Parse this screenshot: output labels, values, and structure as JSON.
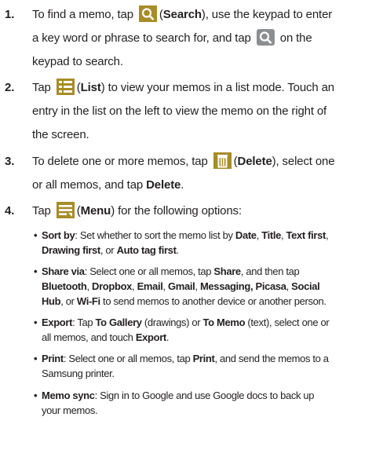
{
  "steps": [
    {
      "num": "1.",
      "t1": "To find a memo, tap ",
      "icon1": "search-icon",
      "b1": "Search",
      "t2": "), use the keypad to enter",
      "t3": "a key word or phrase to search for, and tap ",
      "icon2": "search-icon",
      "t4": " on the",
      "t5": "keypad to search."
    },
    {
      "num": "2.",
      "t1": "Tap ",
      "icon1": "list-icon",
      "b1": "List",
      "t2": ") to view your memos in a list mode. Touch an",
      "t3": "entry in the list on the left to view the memo on the right of",
      "t4": "the screen."
    },
    {
      "num": "3.",
      "t1": "To delete one or more memos, tap ",
      "icon1": "delete-icon",
      "b1": "Delete",
      "t2": "), select one",
      "t3": "or all memos, and tap ",
      "b2": "Delete",
      "t4": "."
    },
    {
      "num": "4.",
      "t1": "Tap ",
      "icon1": "menu-icon",
      "b1": "Menu",
      "t2": ") for the following options:"
    }
  ],
  "bullets": {
    "sort": {
      "label": "Sort by",
      "t1": ": Set whether to sort the memo list by ",
      "b1": "Date",
      "b2": "Title",
      "b3": "Text first",
      "b4": "Drawing first",
      "t2": ", or ",
      "b5": "Auto tag first",
      "t3": "."
    },
    "share": {
      "label": "Share via",
      "t1": ": Select one or all memos, tap ",
      "b1": "Share",
      "t2": ", and then tap",
      "b2": "Bluetooth",
      "b3": "Dropbox",
      "b4": "Email",
      "b5": "Gmail",
      "b6": "Messaging,",
      "b7": "Picasa",
      "b8": "Social",
      "b9": "Hub",
      "t3": ", or ",
      "b10": "Wi-Fi",
      "t4": " to send memos to another device or another person."
    },
    "export": {
      "label": "Export",
      "t1": ": Tap ",
      "b1": "To Gallery",
      "t2": " (drawings) or ",
      "b2": "To Memo",
      "t3": " (text), select one or",
      "t4": "all memos, and touch ",
      "b3": "Export",
      "t5": "."
    },
    "print": {
      "label": "Print",
      "t1": ": Select one or all memos, tap ",
      "b1": "Print",
      "t2": ", and send the memos to a",
      "t3": "Samsung printer."
    },
    "sync": {
      "label": "Memo sync",
      "t1": ": Sign in to Google and use Google docs to back up",
      "t2": "your memos."
    }
  },
  "colors": {
    "icon_bg": "#a78c28",
    "icon_fg": "#ffffff",
    "text": "#231f20"
  }
}
